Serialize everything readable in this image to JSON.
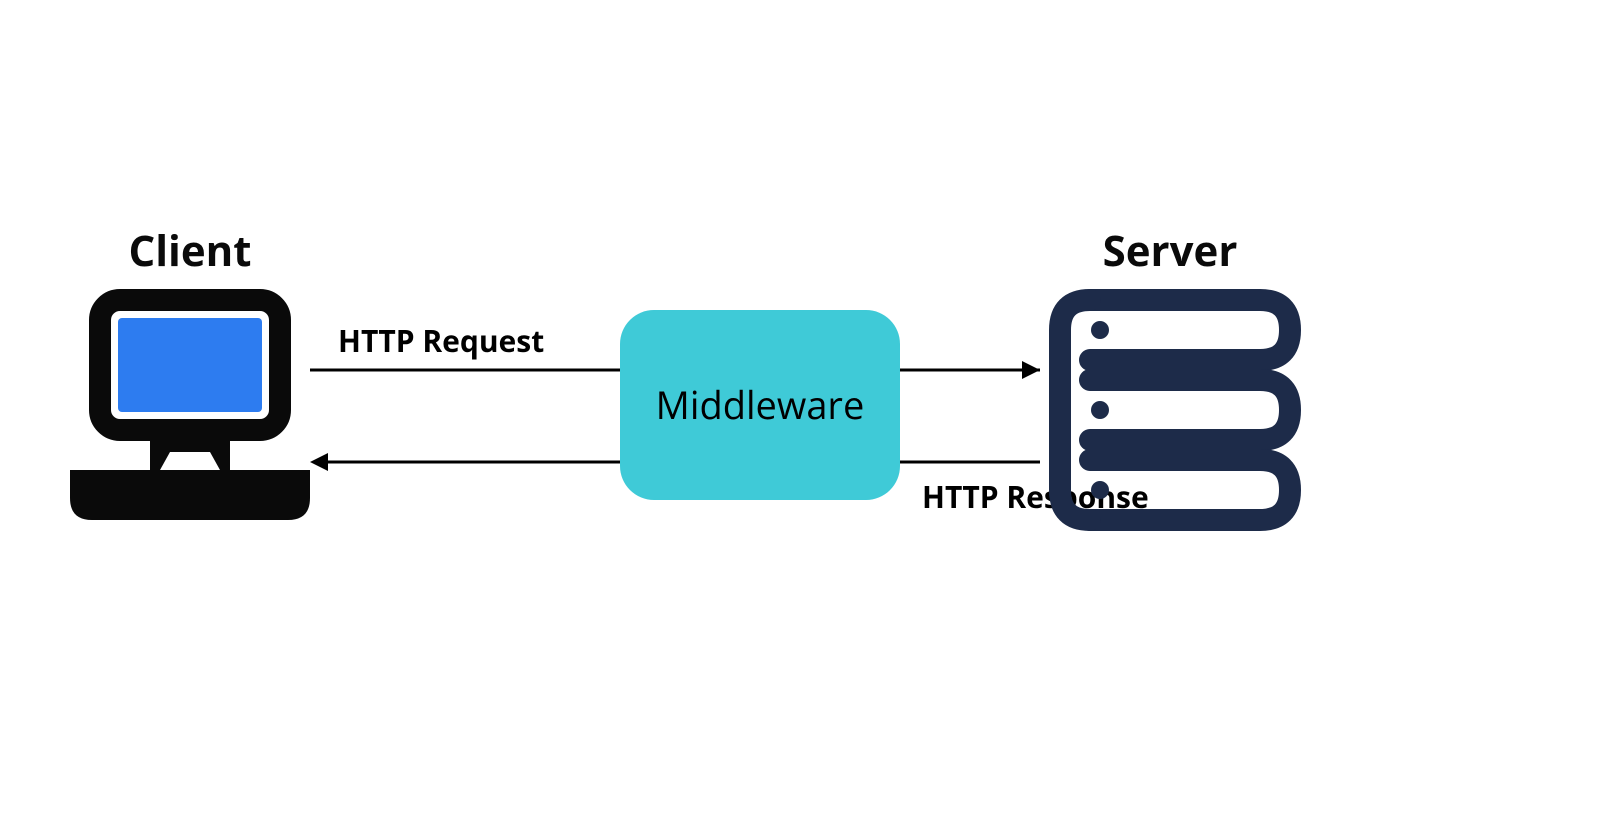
{
  "diagram": {
    "client_label": "Client",
    "server_label": "Server",
    "middleware_label": "Middleware",
    "request_label": "HTTP Request",
    "response_label": "HTTP Response"
  },
  "colors": {
    "middleware_bg": "#3fcad7",
    "laptop_screen": "#2d7cf0",
    "server_icon": "#1d2b49",
    "stroke": "#000000"
  }
}
